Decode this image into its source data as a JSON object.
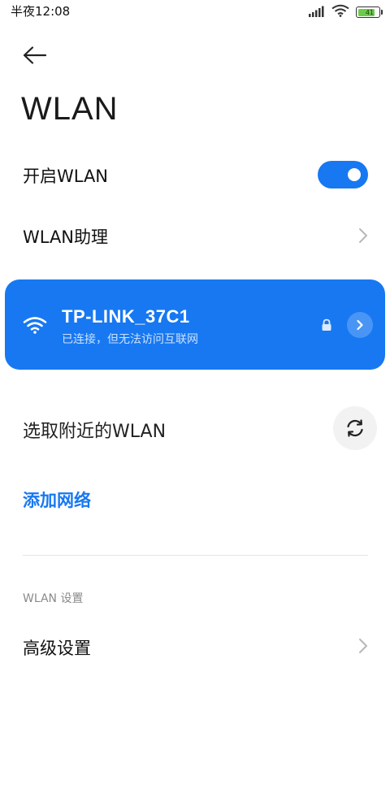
{
  "status_bar": {
    "time": "半夜12:08",
    "battery_level": "41"
  },
  "header": {
    "title": "WLAN"
  },
  "toggle_row": {
    "label": "开启WLAN",
    "enabled": true
  },
  "assistant_row": {
    "label": "WLAN助理"
  },
  "connected_network": {
    "ssid": "TP-LINK_37C1",
    "status": "已连接，但无法访问互联网",
    "locked": true
  },
  "nearby": {
    "label": "选取附近的WLAN"
  },
  "add_network": {
    "label": "添加网络"
  },
  "settings_group": {
    "header": "WLAN 设置",
    "advanced_label": "高级设置"
  },
  "colors": {
    "accent": "#1778f2",
    "chevron": "#b8b8b8"
  }
}
